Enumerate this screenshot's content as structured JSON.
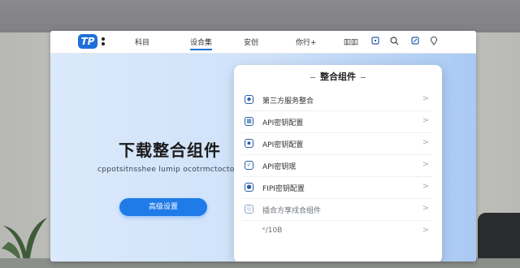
{
  "brand": {
    "logo_text": "TP"
  },
  "nav": {
    "items": [
      "科目",
      "设合集",
      "安创",
      "你行+",
      "吅吅"
    ],
    "active_index": 1,
    "icons": [
      "box-icon",
      "search-icon",
      "edit-icon",
      "location-icon"
    ]
  },
  "hero": {
    "title": "下载整合组件",
    "subtitle": "cppotsitnsshee lumip ocotrmctoctoonne",
    "button_label": "高级设置"
  },
  "panel": {
    "title": "整合组件",
    "items": [
      {
        "label": "第三方服务整合",
        "icon": "shield-icon"
      },
      {
        "label": "API密钥配置",
        "icon": "calendar-icon"
      },
      {
        "label": "API密钥配置",
        "icon": "grid-icon"
      },
      {
        "label": "API密钥珉",
        "icon": "doc-icon"
      },
      {
        "label": "FIPI密钥配置",
        "icon": "user-icon"
      },
      {
        "label": "插合方享戍合组件",
        "icon": "globe-icon"
      },
      {
        "label": "ᵉ/10B",
        "icon": ""
      }
    ]
  },
  "colors": {
    "accent": "#1e6fd9",
    "button": "#1f7be8"
  }
}
